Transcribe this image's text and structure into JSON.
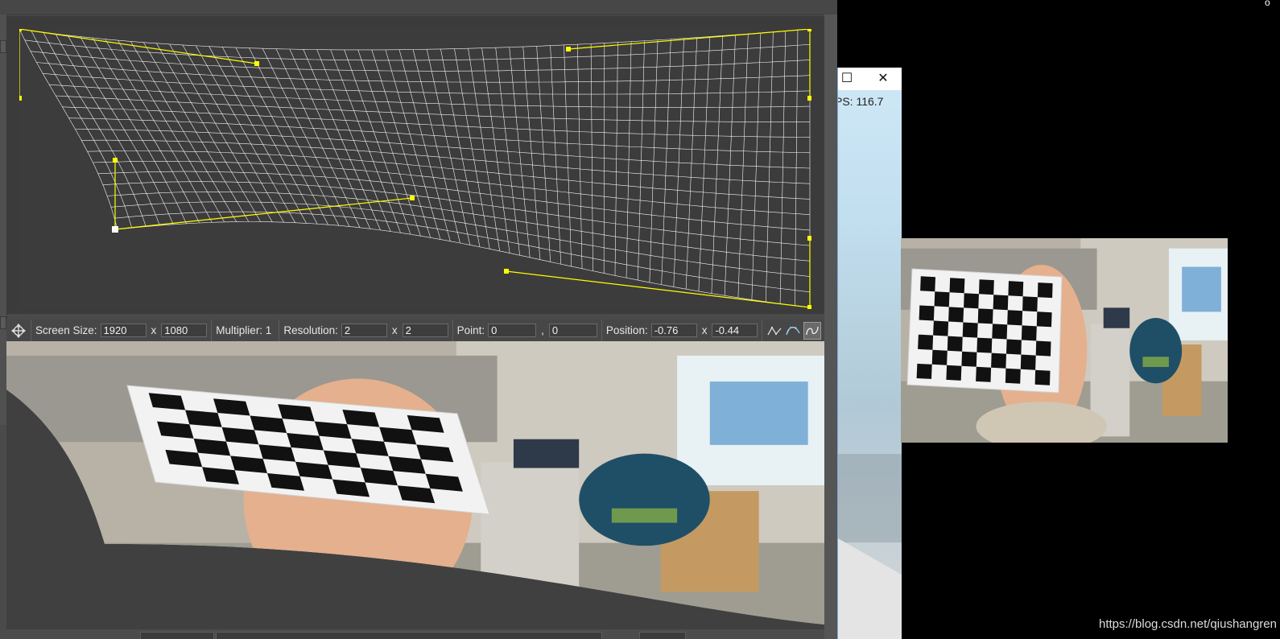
{
  "toolbar": {
    "screen_size_label": "Screen Size:",
    "screen_width": "1920",
    "screen_x": "x",
    "screen_height": "1080",
    "multiplier_label": "Multiplier: 1",
    "resolution_label": "Resolution:",
    "resolution_x": "2",
    "resolution_sep": "x",
    "resolution_y": "2",
    "point_label": "Point:",
    "point_x": "0",
    "point_sep": ",",
    "point_y": "0",
    "position_label": "Position:",
    "position_x": "-0.76",
    "position_sep": "x",
    "position_y": "-0.44"
  },
  "preview_window": {
    "fps_text": "PS: 116.7",
    "maximize_glyph": "☐",
    "close_glyph": "✕"
  },
  "colors": {
    "handle": "#ffff00",
    "grid_line": "#ffffff",
    "panel_bg": "#3b3b3b"
  },
  "corner_glyph": "ȯ",
  "watermark": "https://blog.csdn.net/qiushangren"
}
